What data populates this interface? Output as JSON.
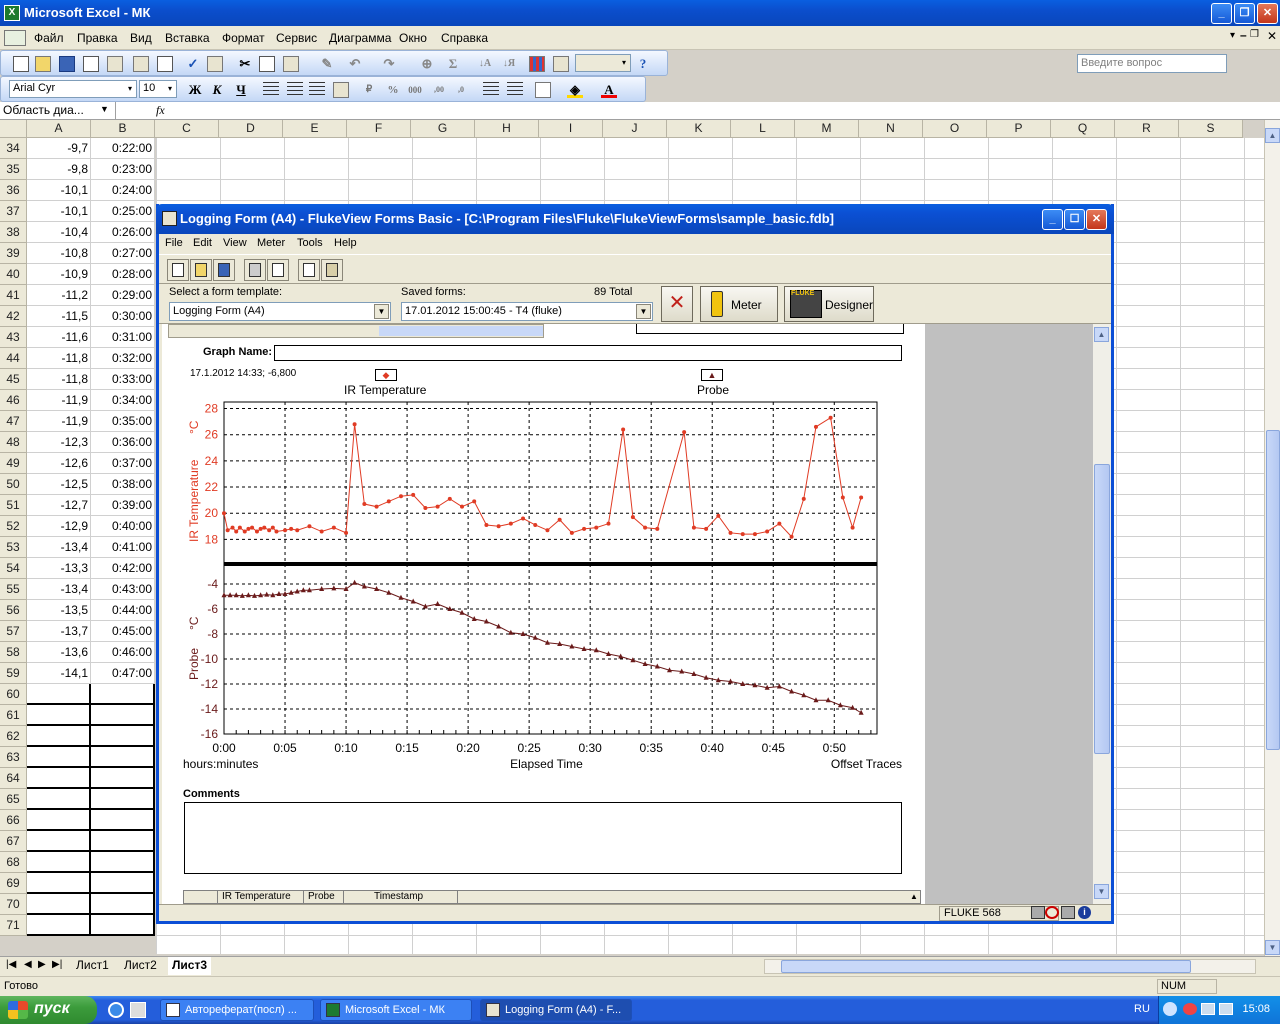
{
  "excel": {
    "title": "Microsoft Excel - МК",
    "menu": [
      "Файл",
      "Правка",
      "Вид",
      "Вставка",
      "Формат",
      "Сервис",
      "Диаграмма",
      "Окно",
      "Справка"
    ],
    "ask_placeholder": "Введите вопрос",
    "font_name": "Arial Cyr",
    "font_size": "10",
    "namebox": "Область диа...",
    "fx": "fx",
    "columns": [
      "A",
      "B",
      "C",
      "D",
      "E",
      "F",
      "G",
      "H",
      "I",
      "J",
      "K",
      "L",
      "M",
      "N",
      "O",
      "P",
      "Q",
      "R",
      "S"
    ],
    "rows": [
      {
        "n": "34",
        "a": "-9,7",
        "b": "0:22:00"
      },
      {
        "n": "35",
        "a": "-9,8",
        "b": "0:23:00"
      },
      {
        "n": "36",
        "a": "-10,1",
        "b": "0:24:00"
      },
      {
        "n": "37",
        "a": "-10,1",
        "b": "0:25:00"
      },
      {
        "n": "38",
        "a": "-10,4",
        "b": "0:26:00"
      },
      {
        "n": "39",
        "a": "-10,8",
        "b": "0:27:00"
      },
      {
        "n": "40",
        "a": "-10,9",
        "b": "0:28:00"
      },
      {
        "n": "41",
        "a": "-11,2",
        "b": "0:29:00"
      },
      {
        "n": "42",
        "a": "-11,5",
        "b": "0:30:00"
      },
      {
        "n": "43",
        "a": "-11,6",
        "b": "0:31:00"
      },
      {
        "n": "44",
        "a": "-11,8",
        "b": "0:32:00"
      },
      {
        "n": "45",
        "a": "-11,8",
        "b": "0:33:00"
      },
      {
        "n": "46",
        "a": "-11,9",
        "b": "0:34:00"
      },
      {
        "n": "47",
        "a": "-11,9",
        "b": "0:35:00"
      },
      {
        "n": "48",
        "a": "-12,3",
        "b": "0:36:00"
      },
      {
        "n": "49",
        "a": "-12,6",
        "b": "0:37:00"
      },
      {
        "n": "50",
        "a": "-12,5",
        "b": "0:38:00"
      },
      {
        "n": "51",
        "a": "-12,7",
        "b": "0:39:00"
      },
      {
        "n": "52",
        "a": "-12,9",
        "b": "0:40:00"
      },
      {
        "n": "53",
        "a": "-13,4",
        "b": "0:41:00"
      },
      {
        "n": "54",
        "a": "-13,3",
        "b": "0:42:00"
      },
      {
        "n": "55",
        "a": "-13,4",
        "b": "0:43:00"
      },
      {
        "n": "56",
        "a": "-13,5",
        "b": "0:44:00"
      },
      {
        "n": "57",
        "a": "-13,7",
        "b": "0:45:00"
      },
      {
        "n": "58",
        "a": "-13,6",
        "b": "0:46:00"
      },
      {
        "n": "59",
        "a": "-14,1",
        "b": "0:47:00"
      },
      {
        "n": "60",
        "a": "",
        "b": ""
      },
      {
        "n": "61",
        "a": "",
        "b": ""
      },
      {
        "n": "62",
        "a": "",
        "b": ""
      },
      {
        "n": "63",
        "a": "",
        "b": ""
      },
      {
        "n": "64",
        "a": "",
        "b": ""
      },
      {
        "n": "65",
        "a": "",
        "b": ""
      },
      {
        "n": "66",
        "a": "",
        "b": ""
      },
      {
        "n": "67",
        "a": "",
        "b": ""
      },
      {
        "n": "68",
        "a": "",
        "b": ""
      },
      {
        "n": "69",
        "a": "",
        "b": ""
      },
      {
        "n": "70",
        "a": "",
        "b": ""
      },
      {
        "n": "71",
        "a": "",
        "b": ""
      }
    ],
    "sheets": [
      "Лист1",
      "Лист2",
      "Лист3"
    ],
    "active_sheet": "Лист3",
    "status": "Готово",
    "num": "NUM"
  },
  "taskbar": {
    "start": "пуск",
    "tasks": [
      "Автореферат(посл) ...",
      "Microsoft Excel - МК",
      "Logging Form (A4) - F..."
    ],
    "lang": "RU",
    "clock": "15:08"
  },
  "fluke": {
    "title": "Logging Form (A4) - FlukeView Forms Basic - [C:\\Program Files\\Fluke\\FlukeViewForms\\sample_basic.fdb]",
    "menu": [
      "File",
      "Edit",
      "View",
      "Meter",
      "Tools",
      "Help"
    ],
    "template_label": "Select a form template:",
    "template_value": "Logging Form (A4)",
    "saved_label": "Saved forms:",
    "saved_total": "89  Total",
    "saved_value": "17.01.2012 15:00:45 - T4 (fluke)",
    "meter_btn": "Meter",
    "designer_btn": "Designer",
    "designer_logo": "FLUKE",
    "graph_name_label": "Graph Name:",
    "cursor_info": "17.1.2012 14:33; -6,800",
    "comments_label": "Comments",
    "table_headers": [
      "IR Temperature",
      "Probe",
      "Timestamp"
    ],
    "status_meter": "FLUKE 568"
  },
  "chart_data": {
    "type": "line",
    "x_unit_label": "hours:minutes",
    "xlabel": "Elapsed Time",
    "offset_label": "Offset Traces",
    "xticks": [
      "0:00",
      "0:05",
      "0:10",
      "0:15",
      "0:20",
      "0:25",
      "0:30",
      "0:35",
      "0:40",
      "0:45",
      "0:50"
    ],
    "xlim": [
      0,
      53.5
    ],
    "top": {
      "name": "IR Temperature",
      "ylabel": "IR Temperature",
      "unit": "°C",
      "yticks": [
        "28",
        "26",
        "24",
        "22",
        "20",
        "18"
      ],
      "ylim": [
        16.5,
        28.5
      ],
      "color": "#e03b24",
      "points": [
        [
          0,
          20
        ],
        [
          0.3,
          18.7
        ],
        [
          0.7,
          18.9
        ],
        [
          1,
          18.6
        ],
        [
          1.3,
          18.9
        ],
        [
          1.7,
          18.6
        ],
        [
          2,
          18.8
        ],
        [
          2.3,
          18.9
        ],
        [
          2.7,
          18.6
        ],
        [
          3,
          18.8
        ],
        [
          3.3,
          18.9
        ],
        [
          3.7,
          18.7
        ],
        [
          4,
          18.9
        ],
        [
          4.3,
          18.6
        ],
        [
          5,
          18.7
        ],
        [
          5.5,
          18.8
        ],
        [
          6,
          18.7
        ],
        [
          7,
          19
        ],
        [
          8,
          18.6
        ],
        [
          9,
          18.9
        ],
        [
          10,
          18.5
        ],
        [
          10.7,
          26.8
        ],
        [
          11.5,
          20.7
        ],
        [
          12.5,
          20.5
        ],
        [
          13.5,
          20.9
        ],
        [
          14.5,
          21.3
        ],
        [
          15.5,
          21.4
        ],
        [
          16.5,
          20.4
        ],
        [
          17.5,
          20.5
        ],
        [
          18.5,
          21.1
        ],
        [
          19.5,
          20.5
        ],
        [
          20.5,
          20.9
        ],
        [
          21.5,
          19.1
        ],
        [
          22.5,
          19
        ],
        [
          23.5,
          19.2
        ],
        [
          24.5,
          19.6
        ],
        [
          25.5,
          19.1
        ],
        [
          26.5,
          18.7
        ],
        [
          27.5,
          19.5
        ],
        [
          28.5,
          18.5
        ],
        [
          29.5,
          18.8
        ],
        [
          30.5,
          18.9
        ],
        [
          31.5,
          19.2
        ],
        [
          32.7,
          26.4
        ],
        [
          33.5,
          19.7
        ],
        [
          34.5,
          18.9
        ],
        [
          35.5,
          18.8
        ],
        [
          37.7,
          26.2
        ],
        [
          38.5,
          18.9
        ],
        [
          39.5,
          18.8
        ],
        [
          40.5,
          19.8
        ],
        [
          41.5,
          18.5
        ],
        [
          42.5,
          18.4
        ],
        [
          43.5,
          18.4
        ],
        [
          44.5,
          18.6
        ],
        [
          45.5,
          19.2
        ],
        [
          46.5,
          18.2
        ],
        [
          47.5,
          21.1
        ],
        [
          48.5,
          26.6
        ],
        [
          49.7,
          27.3
        ],
        [
          50.7,
          21.2
        ],
        [
          51.5,
          18.9
        ],
        [
          52.2,
          21.2
        ]
      ]
    },
    "bottom": {
      "name": "Probe",
      "ylabel": "Probe",
      "unit": "°C",
      "yticks": [
        "-4",
        "-6",
        "-8",
        "-10",
        "-12",
        "-14",
        "-16"
      ],
      "ylim": [
        -16,
        -2.8
      ],
      "color": "#6a1a1a",
      "points": [
        [
          0,
          -4.9
        ],
        [
          0.5,
          -4.9
        ],
        [
          1,
          -4.9
        ],
        [
          1.5,
          -4.95
        ],
        [
          2,
          -4.9
        ],
        [
          2.5,
          -4.95
        ],
        [
          3,
          -4.9
        ],
        [
          3.5,
          -4.85
        ],
        [
          4,
          -4.9
        ],
        [
          4.5,
          -4.8
        ],
        [
          5,
          -4.8
        ],
        [
          5.5,
          -4.7
        ],
        [
          6,
          -4.6
        ],
        [
          6.5,
          -4.5
        ],
        [
          7,
          -4.5
        ],
        [
          8,
          -4.4
        ],
        [
          9,
          -4.35
        ],
        [
          10,
          -4.4
        ],
        [
          10.7,
          -3.9
        ],
        [
          11.5,
          -4.2
        ],
        [
          12.5,
          -4.4
        ],
        [
          13.5,
          -4.7
        ],
        [
          14.5,
          -5.1
        ],
        [
          15.5,
          -5.4
        ],
        [
          16.5,
          -5.8
        ],
        [
          17.5,
          -5.6
        ],
        [
          18.5,
          -6
        ],
        [
          19.5,
          -6.3
        ],
        [
          20.5,
          -6.8
        ],
        [
          21.5,
          -7
        ],
        [
          22.5,
          -7.4
        ],
        [
          23.5,
          -7.9
        ],
        [
          24.5,
          -8
        ],
        [
          25.5,
          -8.3
        ],
        [
          26.5,
          -8.7
        ],
        [
          27.5,
          -8.8
        ],
        [
          28.5,
          -9
        ],
        [
          29.5,
          -9.2
        ],
        [
          30.5,
          -9.3
        ],
        [
          31.5,
          -9.6
        ],
        [
          32.5,
          -9.8
        ],
        [
          33.5,
          -10.1
        ],
        [
          34.5,
          -10.4
        ],
        [
          35.5,
          -10.6
        ],
        [
          36.5,
          -10.9
        ],
        [
          37.5,
          -11
        ],
        [
          38.5,
          -11.2
        ],
        [
          39.5,
          -11.5
        ],
        [
          40.5,
          -11.7
        ],
        [
          41.5,
          -11.8
        ],
        [
          42.5,
          -12
        ],
        [
          43.5,
          -12.1
        ],
        [
          44.5,
          -12.3
        ],
        [
          45.5,
          -12.2
        ],
        [
          46.5,
          -12.6
        ],
        [
          47.5,
          -12.9
        ],
        [
          48.5,
          -13.3
        ],
        [
          49.5,
          -13.3
        ],
        [
          50.5,
          -13.7
        ],
        [
          51.5,
          -13.9
        ],
        [
          52.2,
          -14.3
        ]
      ]
    }
  }
}
